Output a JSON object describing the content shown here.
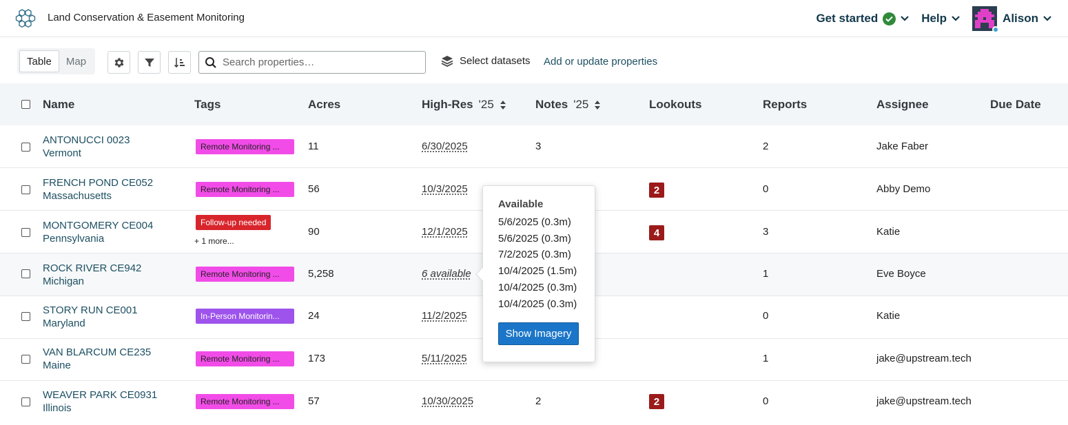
{
  "header": {
    "app_title": "Land Conservation & Easement Monitoring",
    "get_started": "Get started",
    "help": "Help",
    "user_name": "Alison"
  },
  "toolbar": {
    "view_table": "Table",
    "view_map": "Map",
    "search_placeholder": "Search properties…",
    "select_datasets": "Select datasets",
    "add_update": "Add or update properties"
  },
  "columns": {
    "name": "Name",
    "tags": "Tags",
    "acres": "Acres",
    "highres": "High-Res",
    "highres_year": "'25",
    "notes": "Notes",
    "notes_year": "'25",
    "lookouts": "Lookouts",
    "reports": "Reports",
    "assignee": "Assignee",
    "due_date": "Due Date"
  },
  "rows": [
    {
      "name": "ANTONUCCI 0023",
      "state": "Vermont",
      "tag": "Remote Monitoring ...",
      "acres": "11",
      "highres": "6/30/2025",
      "notes": "3",
      "lookouts": "",
      "reports": "2",
      "assignee": "Jake Faber"
    },
    {
      "name": "FRENCH POND CE052",
      "state": "Massachusetts",
      "tag": "Remote Monitoring ...",
      "acres": "56",
      "highres": "10/3/2025",
      "notes": "",
      "lookouts": "2",
      "reports": "0",
      "assignee": "Abby Demo"
    },
    {
      "name": "MONTGOMERY CE004",
      "state": "Pennsylvania",
      "tag": "Follow-up needed",
      "more": "+ 1 more...",
      "acres": "90",
      "highres": "12/1/2025",
      "notes": "",
      "lookouts": "4",
      "reports": "3",
      "assignee": "Katie"
    },
    {
      "name": "ROCK RIVER CE942",
      "state": "Michigan",
      "tag": "Remote Monitoring ...",
      "acres": "5,258",
      "highres": "6 available",
      "notes": "",
      "lookouts": "",
      "reports": "1",
      "assignee": "Eve Boyce"
    },
    {
      "name": "STORY RUN CE001",
      "state": "Maryland",
      "tag": "In-Person Monitorin...",
      "acres": "24",
      "highres": "11/2/2025",
      "notes": "",
      "lookouts": "",
      "reports": "0",
      "assignee": "Katie"
    },
    {
      "name": "VAN BLARCUM CE235",
      "state": "Maine",
      "tag": "Remote Monitoring ...",
      "acres": "173",
      "highres": "5/11/2025",
      "notes": "",
      "lookouts": "",
      "reports": "1",
      "assignee": "jake@upstream.tech"
    },
    {
      "name": "WEAVER PARK CE0931",
      "state": "Illinois",
      "tag": "Remote Monitoring ...",
      "acres": "57",
      "highres": "10/30/2025",
      "notes": "2",
      "lookouts": "2",
      "reports": "0",
      "assignee": "jake@upstream.tech"
    }
  ],
  "popover": {
    "title": "Available",
    "items": [
      "5/6/2025 (0.3m)",
      "5/6/2025 (0.3m)",
      "7/2/2025 (0.3m)",
      "10/4/2025 (1.5m)",
      "10/4/2025 (0.3m)",
      "10/4/2025 (0.3m)"
    ],
    "button": "Show Imagery"
  },
  "colors": {
    "tag_remote": "#f24ce8",
    "tag_inperson": "#9d53ec",
    "tag_followup": "#d8252c",
    "lookout_badge": "#9b1b1b",
    "primary_button": "#1b76c9",
    "link": "#1d4f62",
    "header_bg": "#f3f6f8"
  },
  "icons": {
    "logo": "hexagon-cluster-icon",
    "settings": "gear-icon",
    "filter": "filter-icon",
    "sort": "sort-icon",
    "search": "search-icon",
    "datasets": "layers-icon"
  }
}
